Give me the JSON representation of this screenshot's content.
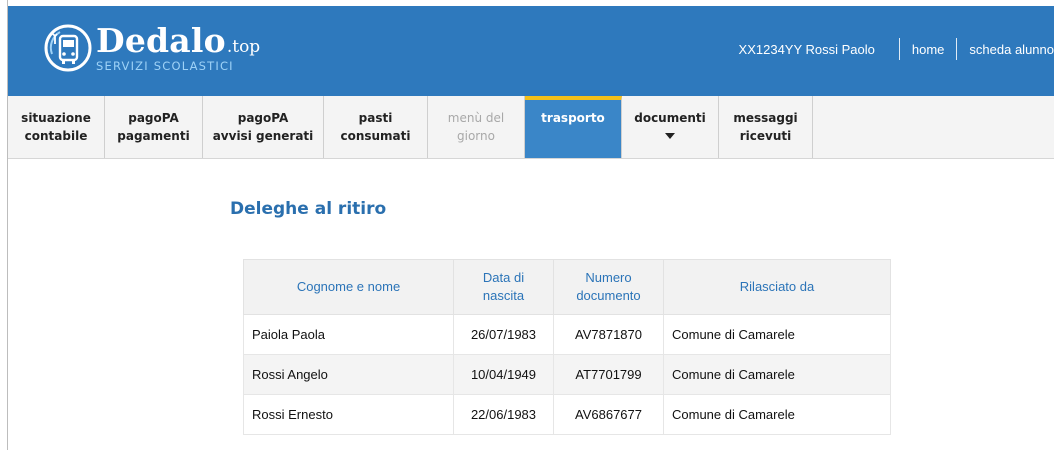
{
  "header": {
    "logo": {
      "title": "Dedalo",
      "suffix": ".top",
      "subtitle": "SERVIZI SCOLASTICI"
    },
    "user": "XX1234YY Rossi Paolo",
    "links": {
      "home": "home",
      "student": "scheda alunno"
    }
  },
  "nav": {
    "items": [
      {
        "line1": "situazione",
        "line2": "contabile",
        "state": "normal"
      },
      {
        "line1": "pagoPA",
        "line2": "pagamenti",
        "state": "normal"
      },
      {
        "line1": "pagoPA",
        "line2": "avvisi generati",
        "state": "normal"
      },
      {
        "line1": "pasti",
        "line2": "consumati",
        "state": "normal"
      },
      {
        "line1": "menù del",
        "line2": "giorno",
        "state": "disabled"
      },
      {
        "line1": "trasporto",
        "line2": "",
        "state": "active"
      },
      {
        "line1": "documenti",
        "line2": "",
        "state": "dropdown"
      },
      {
        "line1": "messaggi",
        "line2": "ricevuti",
        "state": "normal"
      }
    ]
  },
  "main": {
    "title": "Deleghe al ritiro",
    "table": {
      "headers": [
        {
          "line1": "Cognome e nome",
          "line2": ""
        },
        {
          "line1": "Data di",
          "line2": "nascita"
        },
        {
          "line1": "Numero",
          "line2": "documento"
        },
        {
          "line1": "Rilasciato da",
          "line2": ""
        }
      ],
      "rows": [
        [
          "Paiola Paola",
          "26/07/1983",
          "AV7871870",
          "Comune di Camarele"
        ],
        [
          "Rossi Angelo",
          "10/04/1949",
          "AT7701799",
          "Comune di Camarele"
        ],
        [
          "Rossi Ernesto",
          "22/06/1983",
          "AV6867677",
          "Comune di Camarele"
        ]
      ]
    }
  },
  "colors": {
    "header_bg": "#2e79bd",
    "active_tab": "#3a86c8",
    "active_accent": "#f3c01a",
    "link_blue": "#2b74b8"
  }
}
